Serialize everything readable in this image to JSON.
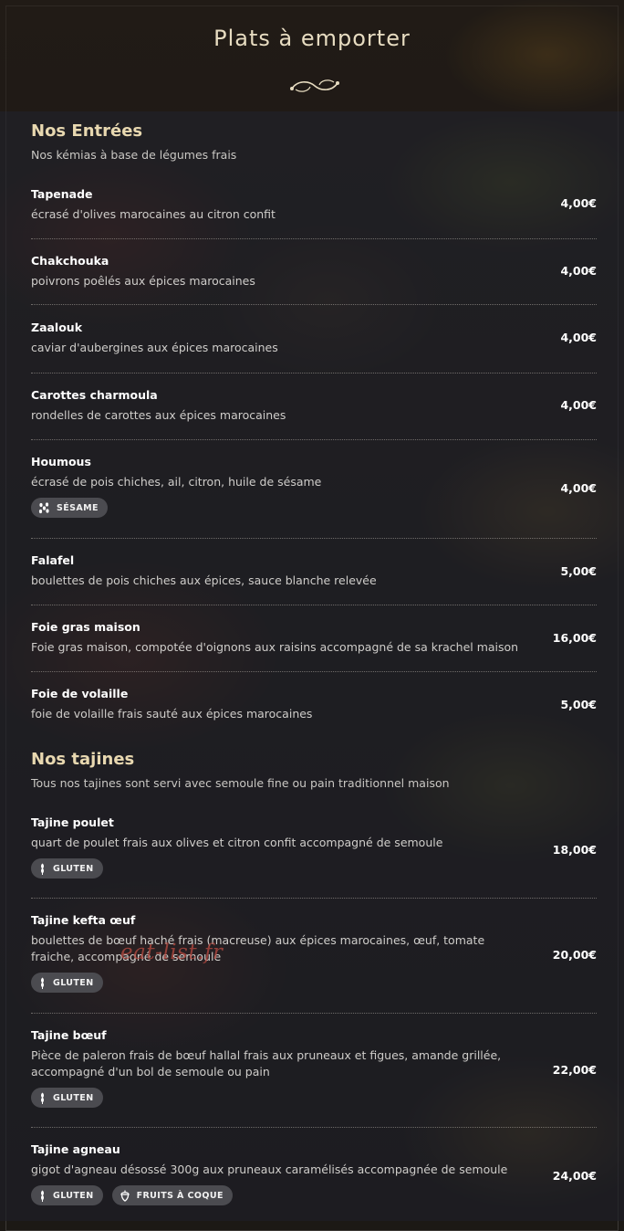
{
  "page": {
    "title": "Plats à emporter"
  },
  "colors": {
    "accent": "#e8d8b0",
    "badge_bg": "#4b4b50",
    "watermark": "#b94b41"
  },
  "sections": [
    {
      "title": "Nos Entrées",
      "subtitle": "Nos kémias à base de légumes frais",
      "items": [
        {
          "name": "Tapenade",
          "description": "écrasé d'olives marocaines au citron confit",
          "price": "4,00€"
        },
        {
          "name": "Chakchouka",
          "description": "poivrons poêlés aux épices marocaines",
          "price": "4,00€"
        },
        {
          "name": "Zaalouk",
          "description": "caviar d'aubergines aux épices marocaines",
          "price": "4,00€"
        },
        {
          "name": "Carottes charmoula",
          "description": "rondelles de carottes aux épices marocaines",
          "price": "4,00€"
        },
        {
          "name": "Houmous",
          "description": "écrasé de pois chiches, ail, citron, huile de sésame",
          "price": "4,00€",
          "badges": [
            {
              "label": "SÉSAME",
              "icon": "sesame-icon"
            }
          ]
        },
        {
          "name": "Falafel",
          "description": "boulettes de pois chiches aux épices, sauce blanche relevée",
          "price": "5,00€"
        },
        {
          "name": "Foie gras maison",
          "description": "Foie gras maison, compotée d'oignons aux raisins accompagné de sa krachel maison",
          "price": "16,00€"
        },
        {
          "name": "Foie de volaille",
          "description": "foie de volaille frais sauté aux épices marocaines",
          "price": "5,00€"
        }
      ]
    },
    {
      "title": "Nos tajines",
      "subtitle": "Tous nos tajines sont servi avec semoule fine ou pain traditionnel maison",
      "items": [
        {
          "name": "Tajine poulet",
          "description": "quart de poulet frais aux olives et citron confit accompagné de semoule",
          "price": "18,00€",
          "badges": [
            {
              "label": "GLUTEN",
              "icon": "wheat-icon"
            }
          ]
        },
        {
          "name": "Tajine kefta œuf",
          "description": "boulettes de bœuf haché frais (macreuse) aux épices marocaines, œuf, tomate fraiche, accompagné de semoule",
          "price": "20,00€",
          "badges": [
            {
              "label": "GLUTEN",
              "icon": "wheat-icon"
            }
          ]
        },
        {
          "name": "Tajine bœuf",
          "description": "Pièce de paleron frais de bœuf hallal frais aux pruneaux et figues, amande grillée, accompagné d'un bol de semoule ou pain",
          "price": "22,00€",
          "badges": [
            {
              "label": "GLUTEN",
              "icon": "wheat-icon"
            }
          ]
        },
        {
          "name": "Tajine agneau",
          "description": "gigot d'agneau désossé 300g aux pruneaux caramélisés accompagnée de semoule",
          "price": "24,00€",
          "badges": [
            {
              "label": "GLUTEN",
              "icon": "wheat-icon"
            },
            {
              "label": "FRUITS À COQUE",
              "icon": "nut-icon"
            }
          ]
        }
      ]
    }
  ],
  "watermark": "eat-list.fr"
}
